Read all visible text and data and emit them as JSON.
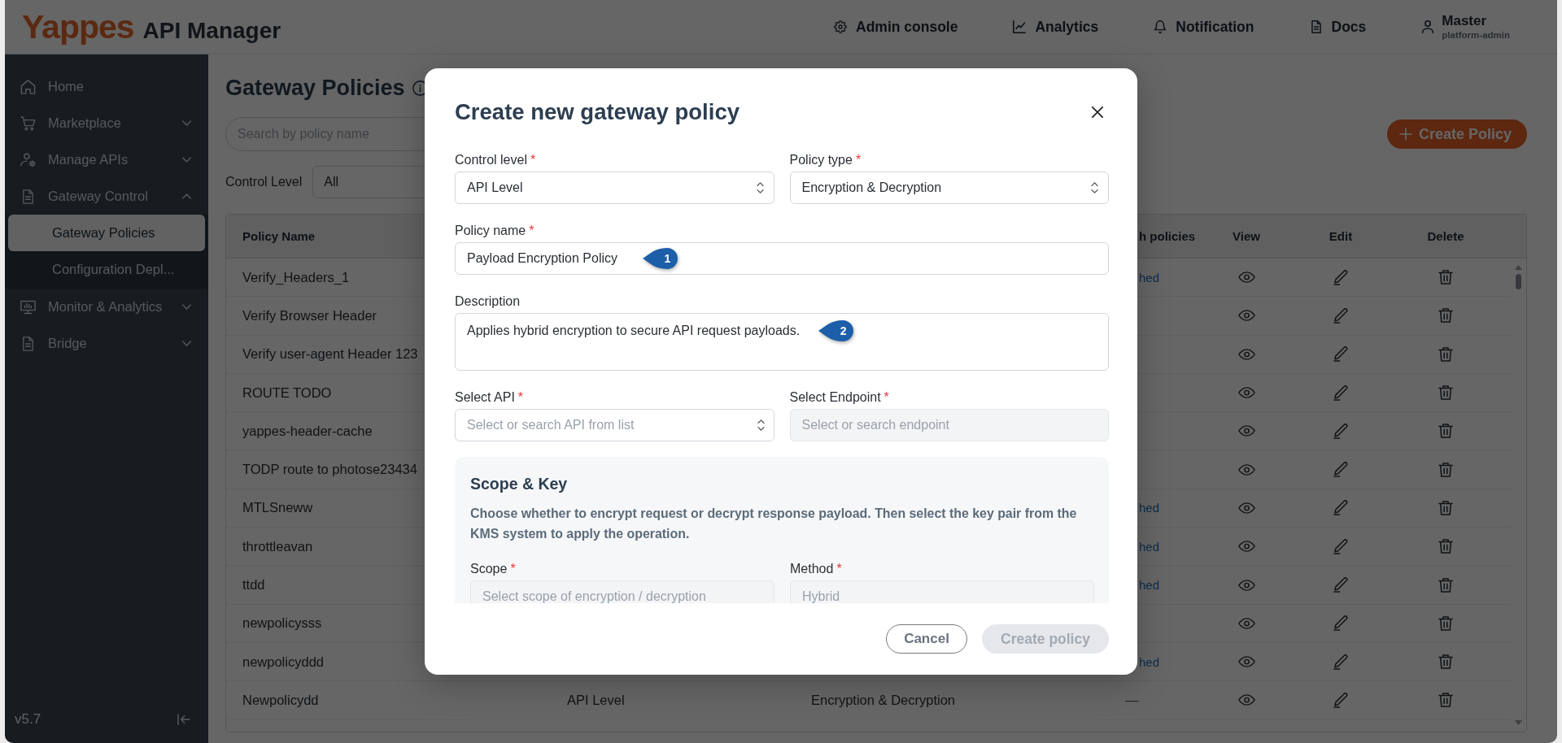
{
  "header": {
    "logo": "Yappes",
    "app_name": "API Manager",
    "nav": [
      {
        "label": "Admin console"
      },
      {
        "label": "Analytics"
      },
      {
        "label": "Notification"
      },
      {
        "label": "Docs"
      }
    ],
    "user": {
      "name": "Master",
      "role": "platform-admin"
    }
  },
  "sidebar": {
    "items": [
      {
        "label": "Home",
        "kind": "link",
        "selected": false
      },
      {
        "label": "Marketplace",
        "kind": "group",
        "selected": false,
        "expanded": false
      },
      {
        "label": "Manage APIs",
        "kind": "group",
        "selected": false,
        "expanded": false
      },
      {
        "label": "Gateway Control",
        "kind": "group",
        "selected": false,
        "expanded": true,
        "children": [
          {
            "label": "Gateway Policies",
            "selected": true
          },
          {
            "label": "Configuration Depl...",
            "selected": false
          }
        ]
      },
      {
        "label": "Monitor & Analytics",
        "kind": "group",
        "selected": false,
        "expanded": false
      },
      {
        "label": "Bridge",
        "kind": "group",
        "selected": false,
        "expanded": false
      }
    ],
    "version": "v5.7"
  },
  "page": {
    "title": "Gateway Policies",
    "search": {
      "placeholder": "Search by policy name"
    },
    "create_button": {
      "label": "Create Policy"
    },
    "filter": {
      "label": "Control Level",
      "value": "All"
    },
    "table": {
      "columns": [
        "Policy Name",
        "h policies",
        "View",
        "Edit",
        "Delete"
      ],
      "rows": [
        {
          "name": "Verify_Headers_1",
          "column_4": {
            "text": "hed",
            "kind": "link"
          }
        },
        {
          "name": "Verify Browser Header"
        },
        {
          "name": "Verify user-agent Header 123"
        },
        {
          "name": "ROUTE TODO"
        },
        {
          "name": "yappes-header-cache"
        },
        {
          "name": "TODP route to photose23434"
        },
        {
          "name": "MTLSneww",
          "column_4": {
            "text": "hed",
            "kind": "link"
          }
        },
        {
          "name": "throttleavan",
          "column_4": {
            "text": "hed",
            "kind": "link"
          }
        },
        {
          "name": "ttdd",
          "column_4": {
            "text": "hed",
            "kind": "link"
          }
        },
        {
          "name": "newpolicysss"
        },
        {
          "name": "newpolicyddd",
          "column_4": {
            "text": "hed",
            "kind": "link"
          }
        },
        {
          "name": "Newpolicydd",
          "column_2": "API Level",
          "column_3": "Encryption & Decryption",
          "column_4": {
            "text": "—",
            "kind": "text"
          }
        }
      ]
    }
  },
  "modal": {
    "title": "Create new gateway policy",
    "rows": [
      [
        {
          "label": "Control level",
          "required_mark": "*",
          "kind": "select",
          "value": "API Level",
          "disabled": false
        },
        {
          "label": "Policy type",
          "required_mark": "*",
          "kind": "select",
          "value": "Encryption & Decryption",
          "disabled": false
        }
      ],
      [
        {
          "label": "Policy name",
          "required_mark": "*",
          "kind": "input",
          "value": "Payload Encryption Policy",
          "disabled": false,
          "marker": "1"
        }
      ],
      [
        {
          "label": "Description",
          "kind": "textarea",
          "value": "Applies hybrid encryption to secure API request payloads.",
          "disabled": false,
          "marker": "2"
        }
      ],
      [
        {
          "label": "Select API",
          "required_mark": "*",
          "kind": "select",
          "placeholder": "Select or search API from list",
          "disabled": false
        },
        {
          "label": "Select Endpoint",
          "required_mark": "*",
          "kind": "input",
          "placeholder": "Select or search endpoint",
          "disabled": true
        }
      ]
    ],
    "section": {
      "title": "Scope & Key",
      "description": "Choose whether to encrypt request or decrypt response payload. Then select the key pair from the KMS system to apply the operation.",
      "rows": [
        [
          {
            "label": "Scope",
            "required_mark": "*",
            "kind": "input",
            "placeholder": "Select scope of encryption / decryption",
            "disabled": true
          },
          {
            "label": "Method",
            "required_mark": "*",
            "kind": "input",
            "placeholder": "Hybrid",
            "disabled": true
          }
        ]
      ]
    },
    "buttons": [
      {
        "label": "Cancel",
        "kind": "secondary",
        "disabled": false
      },
      {
        "label": "Create policy",
        "kind": "primary",
        "disabled": true
      }
    ]
  }
}
